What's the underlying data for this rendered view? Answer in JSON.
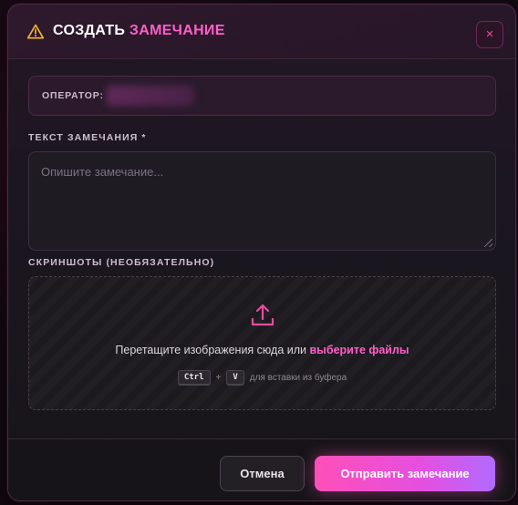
{
  "dialog": {
    "title_prefix": "СОЗДАТЬ",
    "title_accent": "ЗАМЕЧАНИЕ",
    "close_glyph": "×"
  },
  "operator": {
    "label": "ОПЕРАТОР:",
    "value": ""
  },
  "note": {
    "label": "ТЕКСТ ЗАМЕЧАНИЯ *",
    "placeholder": "Опишите замечание..."
  },
  "screenshots": {
    "label": "СКРИНШОТЫ (НЕОБЯЗАТЕЛЬНО)",
    "drop_text": "Перетащите изображения сюда или ",
    "drop_link": "выберите файлы",
    "key1": "Ctrl",
    "plus": "+",
    "key2": "V",
    "paste_hint": "для вставки из буфера"
  },
  "footer": {
    "cancel_label": "Отмена",
    "submit_label": "Отправить замечание"
  },
  "icons": {
    "warning": "warning-triangle-icon",
    "close": "close-icon",
    "upload": "upload-icon"
  },
  "colors": {
    "accent": "#ff5fc8",
    "warning": "#f2b632",
    "submit_gradient_start": "#ff4fb8",
    "submit_gradient_end": "#b16bff"
  }
}
